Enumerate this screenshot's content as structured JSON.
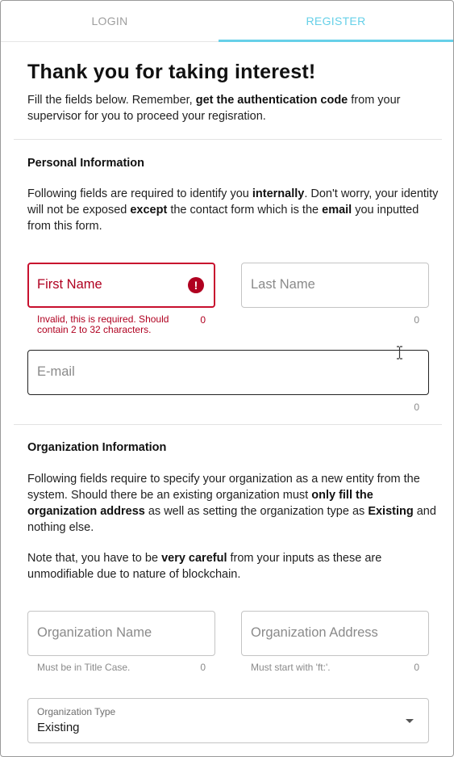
{
  "tabs": {
    "login": "LOGIN",
    "register": "REGISTER"
  },
  "header": {
    "title": "Thank you for taking interest!",
    "intro_1": "Fill the fields below. Remember, ",
    "intro_bold": "get the authentication code",
    "intro_2": " from your supervisor for you to proceed your regisration."
  },
  "personal": {
    "title": "Personal Information",
    "desc_1": "Following fields are required to identify you ",
    "desc_b1": "internally",
    "desc_2": ". Don't worry, your identity will not be exposed ",
    "desc_b2": "except",
    "desc_3": " the contact form which is the ",
    "desc_b3": "email",
    "desc_4": " you inputted from this form.",
    "first_name": {
      "placeholder": "First Name",
      "error": "Invalid, this is required. Should contain 2 to 32 characters.",
      "counter": "0"
    },
    "last_name": {
      "placeholder": "Last Name",
      "counter": "0"
    },
    "email": {
      "placeholder": "E-mail",
      "counter": "0"
    }
  },
  "organization": {
    "title": "Organization Information",
    "desc_1": "Following fields require to specify your organization as a new entity from the system. Should there be an existing organization must ",
    "desc_b1": "only fill the organization address",
    "desc_2": " as well as setting the organization type as ",
    "desc_b2": "Existing",
    "desc_3": " and nothing else.",
    "note_1": "Note that, you have to be ",
    "note_b1": "very careful",
    "note_2": " from your inputs as these are unmodifiable due to nature of blockchain.",
    "org_name": {
      "placeholder": "Organization Name",
      "helper": "Must be in Title Case.",
      "counter": "0"
    },
    "org_address": {
      "placeholder": "Organization Address",
      "helper": "Must start with 'ft:'.",
      "counter": "0"
    },
    "org_type": {
      "label": "Organization Type",
      "value": "Existing"
    }
  },
  "colors": {
    "accent": "#66d0e8",
    "error": "#b00020",
    "border": "#c4c4c4"
  }
}
